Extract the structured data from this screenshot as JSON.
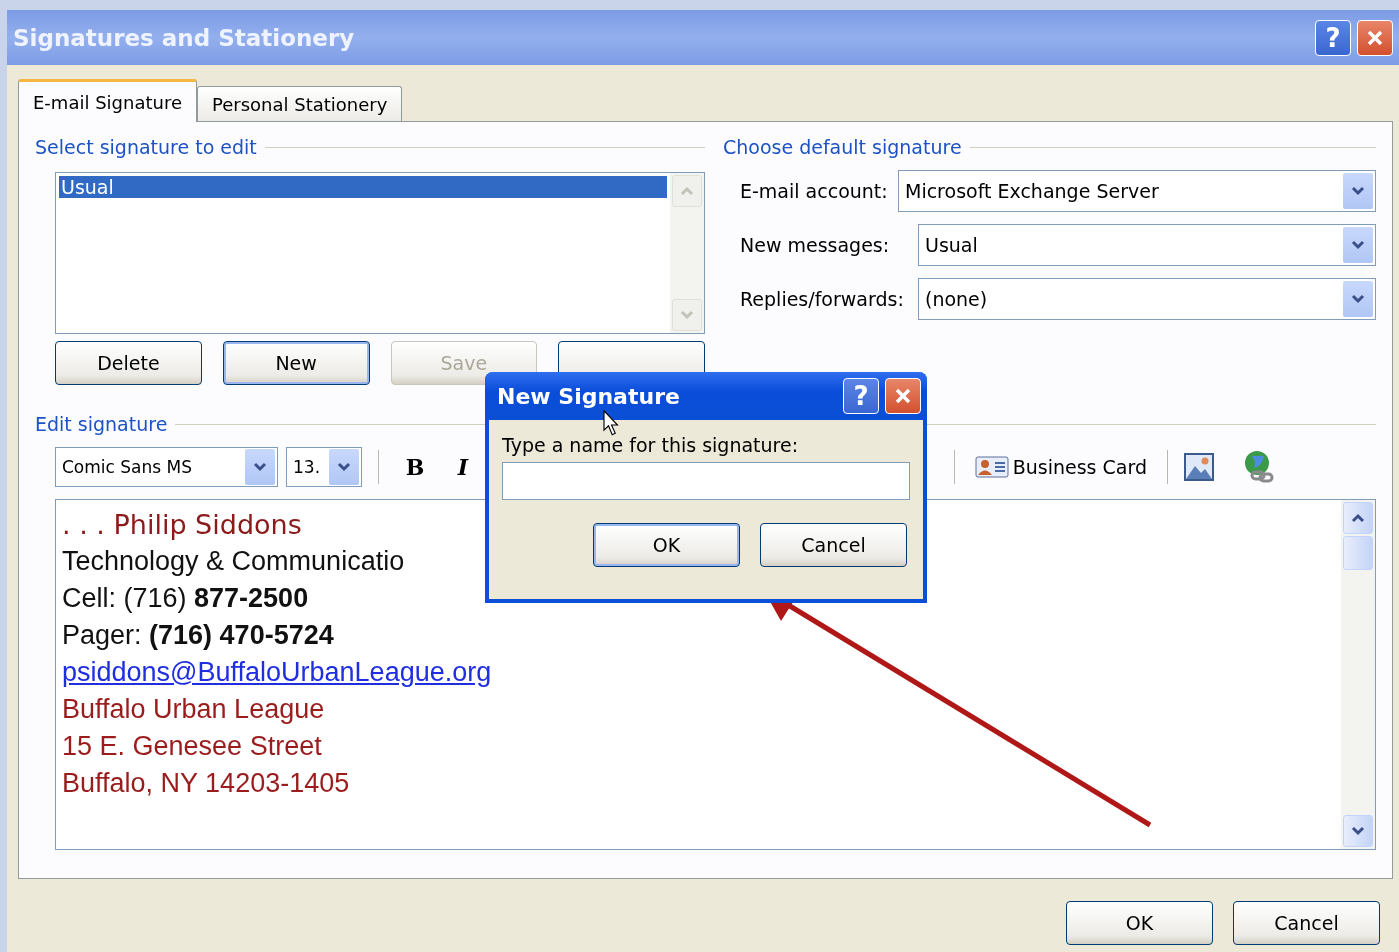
{
  "window": {
    "title": "Signatures and Stationery",
    "help": "?"
  },
  "tabs": [
    {
      "label": "E-mail Signature",
      "selected": true
    },
    {
      "label": "Personal Stationery",
      "selected": false
    }
  ],
  "select_group": {
    "legend": "Select signature to edit",
    "signatures": [
      {
        "name": "Usual",
        "selected": true
      }
    ],
    "buttons": [
      {
        "label": "Delete",
        "disabled": false,
        "default": false
      },
      {
        "label": "New",
        "disabled": false,
        "default": true
      },
      {
        "label": "Save",
        "disabled": true,
        "default": false
      },
      {
        "disabled": false,
        "default": false
      }
    ]
  },
  "default_group": {
    "legend": "Choose default signature",
    "fields": [
      {
        "label": "E-mail account:",
        "value": "Microsoft Exchange Server"
      },
      {
        "label": "New messages:",
        "value": "Usual"
      },
      {
        "label": "Replies/forwards:",
        "value": "(none)"
      }
    ]
  },
  "edit_group": {
    "legend": "Edit signature",
    "font": "Comic Sans MS",
    "size": "13.",
    "toolbar": [
      {
        "kind": "bold",
        "glyph": "B"
      },
      {
        "kind": "italic",
        "glyph": "I"
      }
    ],
    "business_card": "Business Card",
    "body": [
      {
        "kind": "name",
        "text": ". . . Philip Siddons"
      },
      {
        "kind": "plain",
        "text": "Technology & Communicatio"
      },
      {
        "kind": "plain",
        "text": "Cell: (716) **877-2500**"
      },
      {
        "kind": "plain",
        "text": "Pager: **(716) 470-5724**"
      },
      {
        "kind": "link",
        "text": "psiddons@BuffaloUrbanLeague.org"
      },
      {
        "kind": "address",
        "text": "Buffalo Urban League"
      },
      {
        "kind": "address",
        "text": "15 E. Genesee Street"
      },
      {
        "kind": "address",
        "text": "Buffalo, NY 14203-1405"
      }
    ]
  },
  "footer_buttons": [
    {
      "label": "OK"
    },
    {
      "label": "Cancel"
    }
  ],
  "new_dialog": {
    "title": "New Signature",
    "help": "?",
    "prompt": "Type a name for this signature:",
    "buttons": [
      {
        "label": "OK",
        "default": true
      },
      {
        "label": "Cancel",
        "default": false
      }
    ]
  }
}
